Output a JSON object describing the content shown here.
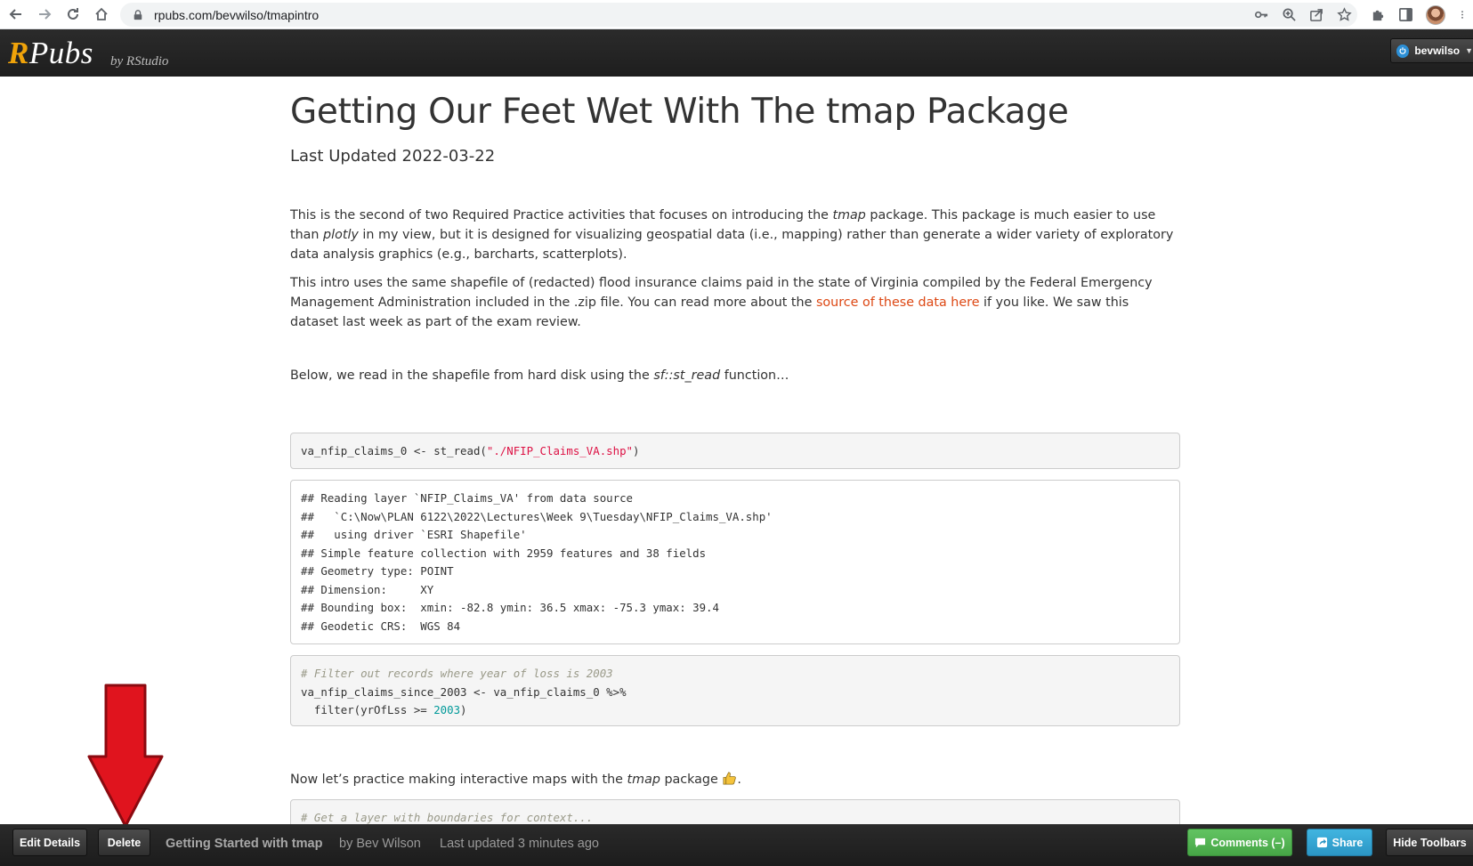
{
  "browser": {
    "url": "rpubs.com/bevwilso/tmapintro"
  },
  "header": {
    "logo_r": "R",
    "logo_rest": "Pubs",
    "by_label": "by RStudio",
    "user_name": "bevwilso"
  },
  "document": {
    "title": "Getting Our Feet Wet With The tmap Package",
    "subtitle": "Last Updated 2022-03-22",
    "p1": {
      "a": "This is the second of two Required Practice activities that focuses on introducing the ",
      "b": "tmap",
      "c": " package. This package is much easier to use than ",
      "d": "plotly",
      "e": " in my view, but it is designed for visualizing geospatial data (i.e., mapping) rather than generate a wider variety of exploratory data analysis graphics (e.g., barcharts, scatterplots)."
    },
    "p2": {
      "a": "This intro uses the same shapefile of (redacted) flood insurance claims paid in the state of Virginia compiled by the Federal Emergency Management Administration included in the .zip file. You can read more about the ",
      "link": "source of these data here",
      "b": " if you like. We saw this dataset last week as part of the exam review."
    },
    "p3": {
      "a": "Below, we read in the shapefile from hard disk using the ",
      "b": "sf::st_read",
      "c": " function…"
    },
    "code1": {
      "a": "va_nfip_claims_0 <- st_read(",
      "str": "\"./NFIP_Claims_VA.shp\"",
      "b": ")"
    },
    "output_lines": [
      "## Reading layer `NFIP_Claims_VA' from data source",
      "##   `C:\\Now\\PLAN 6122\\2022\\Lectures\\Week 9\\Tuesday\\NFIP_Claims_VA.shp'",
      "##   using driver `ESRI Shapefile'",
      "## Simple feature collection with 2959 features and 38 fields",
      "## Geometry type: POINT",
      "## Dimension:     XY",
      "## Bounding box:  xmin: -82.8 ymin: 36.5 xmax: -75.3 ymax: 39.4",
      "## Geodetic CRS:  WGS 84"
    ],
    "code2": {
      "comment": "# Filter out records where year of loss is 2003",
      "line2": "va_nfip_claims_since_2003 <- va_nfip_claims_0 %>%",
      "line3a": "  filter(yrOfLss >= ",
      "num": "2003",
      "line3b": ")"
    },
    "p4": {
      "a": "Now let’s practice making interactive maps with the ",
      "b": "tmap",
      "c": " package ",
      "d": "."
    },
    "code3": {
      "comment": "# Get a layer with boundaries for context..."
    }
  },
  "footer": {
    "edit_details": "Edit Details",
    "delete": "Delete",
    "doc_title": "Getting Started with tmap",
    "author": "by Bev Wilson",
    "updated": "Last updated 3 minutes ago",
    "comments": "Comments (–)",
    "share": "Share",
    "hide_toolbars": "Hide Toolbars"
  },
  "colors": {
    "annotation_arrow": "#e0141e",
    "link": "#dd4814",
    "logo_accent": "#f0a30a"
  }
}
